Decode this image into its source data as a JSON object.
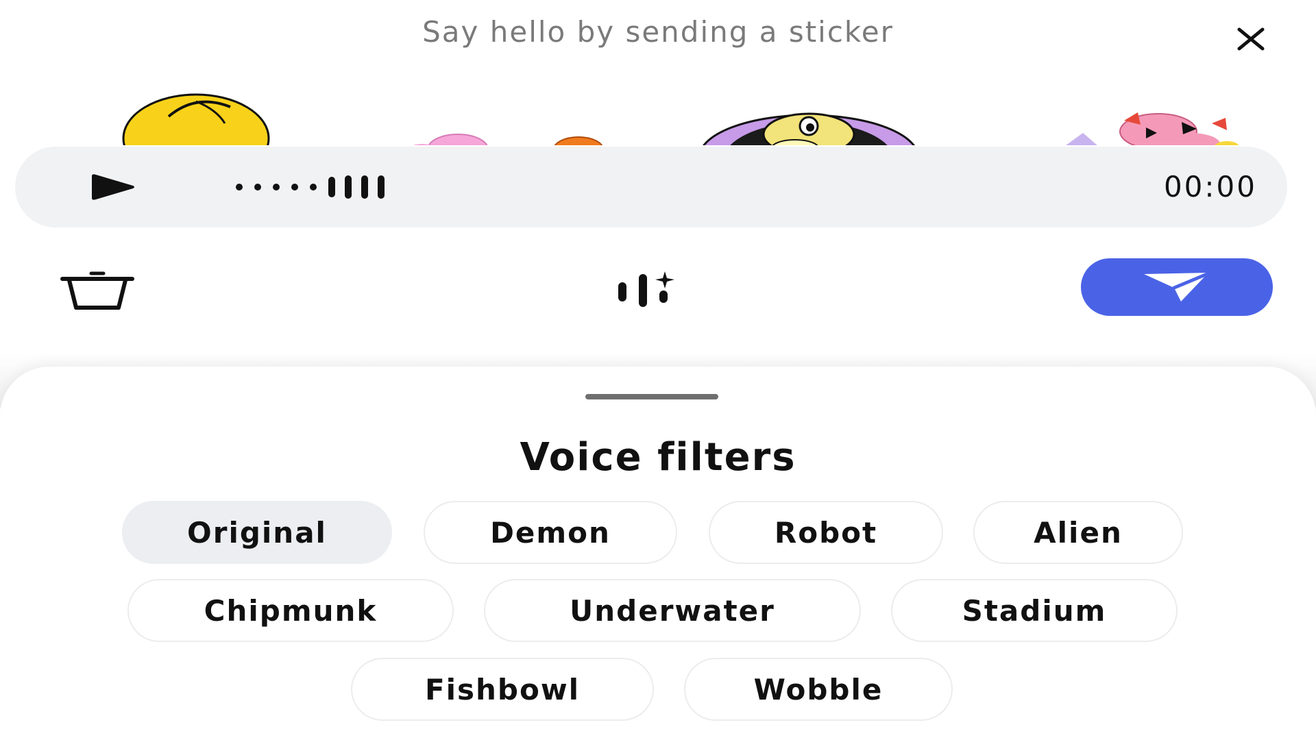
{
  "header": {
    "title": "Say hello by sending a sticker",
    "close_icon": "close-icon"
  },
  "stickers": [
    "yellow-blob-sticker",
    "pink-hand-sticker",
    "orange-hat-sticker",
    "purple-flower-face-sticker",
    "pink-creatures-sticker"
  ],
  "voice_player": {
    "play_icon": "play-icon",
    "waveform_icon": "waveform-icon",
    "timer": "00:00"
  },
  "actions": {
    "delete_icon": "trash-icon",
    "voice_filter_icon": "voice-filter-sparkle-icon",
    "send_icon": "send-icon",
    "send_color": "#4a63e6"
  },
  "voice_filters": {
    "title": "Voice filters",
    "selected": "Original",
    "options": [
      "Original",
      "Demon",
      "Robot",
      "Alien",
      "Chipmunk",
      "Underwater",
      "Stadium",
      "Fishbowl",
      "Wobble"
    ]
  }
}
